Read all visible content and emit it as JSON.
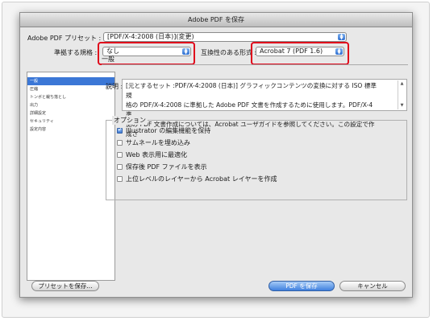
{
  "window": {
    "title": "Adobe PDF を保存"
  },
  "header": {
    "preset_label": "Adobe PDF プリセット :",
    "preset_value": "[PDF/X-4:2008 (日本)](変更)",
    "standard_label": "準拠する規格 :",
    "standard_value": "なし",
    "compat_label": "互換性のある形式 :",
    "compat_value": "Acrobat 7 (PDF 1.6)"
  },
  "sidebar": {
    "items": [
      {
        "label": "一般",
        "selected": true
      },
      {
        "label": "圧縮",
        "selected": false
      },
      {
        "label": "トンボと裁ち落とし",
        "selected": false
      },
      {
        "label": "出力",
        "selected": false
      },
      {
        "label": "詳細設定",
        "selected": false
      },
      {
        "label": "セキュリティ",
        "selected": false
      },
      {
        "label": "設定内容",
        "selected": false
      }
    ]
  },
  "main": {
    "section_title": "一般",
    "description_label": "説明 :",
    "description_text": "[元とするセット :PDF/X-4:2008 (日本)] グラフィックコンテンツの変換に対する ISO 標準規\n格の PDF/X-4:2008 に準拠した Adobe PDF 文書を作成するために使用します。PDF/X-4 準\n拠の PDF 文書作成については、Acrobat ユーザガイドを参照してください。この設定で作成さ",
    "options_title": "オプション",
    "options": [
      {
        "label": "Illustrator の編集機能を保持",
        "checked": true
      },
      {
        "label": "サムネールを埋め込み",
        "checked": false
      },
      {
        "label": "Web 表示用に最適化",
        "checked": false
      },
      {
        "label": "保存後 PDF ファイルを表示",
        "checked": false
      },
      {
        "label": "上位レベルのレイヤーから Acrobat レイヤーを作成",
        "checked": false
      }
    ]
  },
  "footer": {
    "save_preset_label": "プリセットを保存...",
    "save_pdf_label": "PDF を保存",
    "cancel_label": "キャンセル"
  },
  "colors": {
    "highlight_box": "#e0071b",
    "selection_blue": "#3b77d6"
  }
}
